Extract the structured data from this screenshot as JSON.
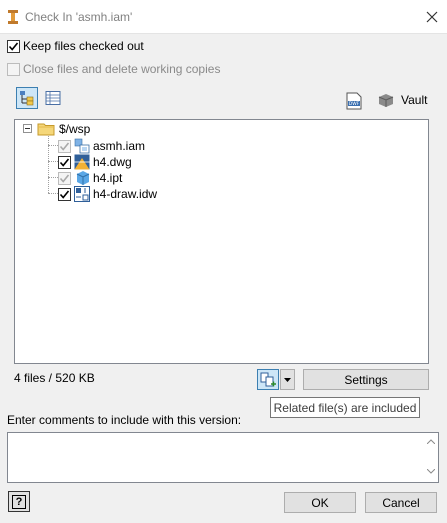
{
  "window": {
    "title": "Check In 'asmh.iam'"
  },
  "options": {
    "keep_checked_out": {
      "label": "Keep files checked out",
      "checked": true
    },
    "close_files": {
      "label": "Close files and delete working copies",
      "checked": false
    }
  },
  "toolbar": {
    "vault_label": "Vault"
  },
  "tree": {
    "root": "$/wsp",
    "items": [
      {
        "label": "asmh.iam",
        "checked": true,
        "disabled": true,
        "icon": "assembly-icon"
      },
      {
        "label": "h4.dwg",
        "checked": true,
        "disabled": false,
        "icon": "dwg-icon"
      },
      {
        "label": "h4.ipt",
        "checked": true,
        "disabled": true,
        "icon": "part-icon"
      },
      {
        "label": "h4-draw.idw",
        "checked": true,
        "disabled": false,
        "icon": "drawing-icon"
      }
    ]
  },
  "status": {
    "summary": "4 files / 520 KB"
  },
  "settings_label": "Settings",
  "tooltip": "Related file(s) are included",
  "comments": {
    "label": "Enter comments to include with this version:",
    "value": ""
  },
  "footer": {
    "help_label": "?",
    "ok_label": "OK",
    "cancel_label": "Cancel"
  }
}
